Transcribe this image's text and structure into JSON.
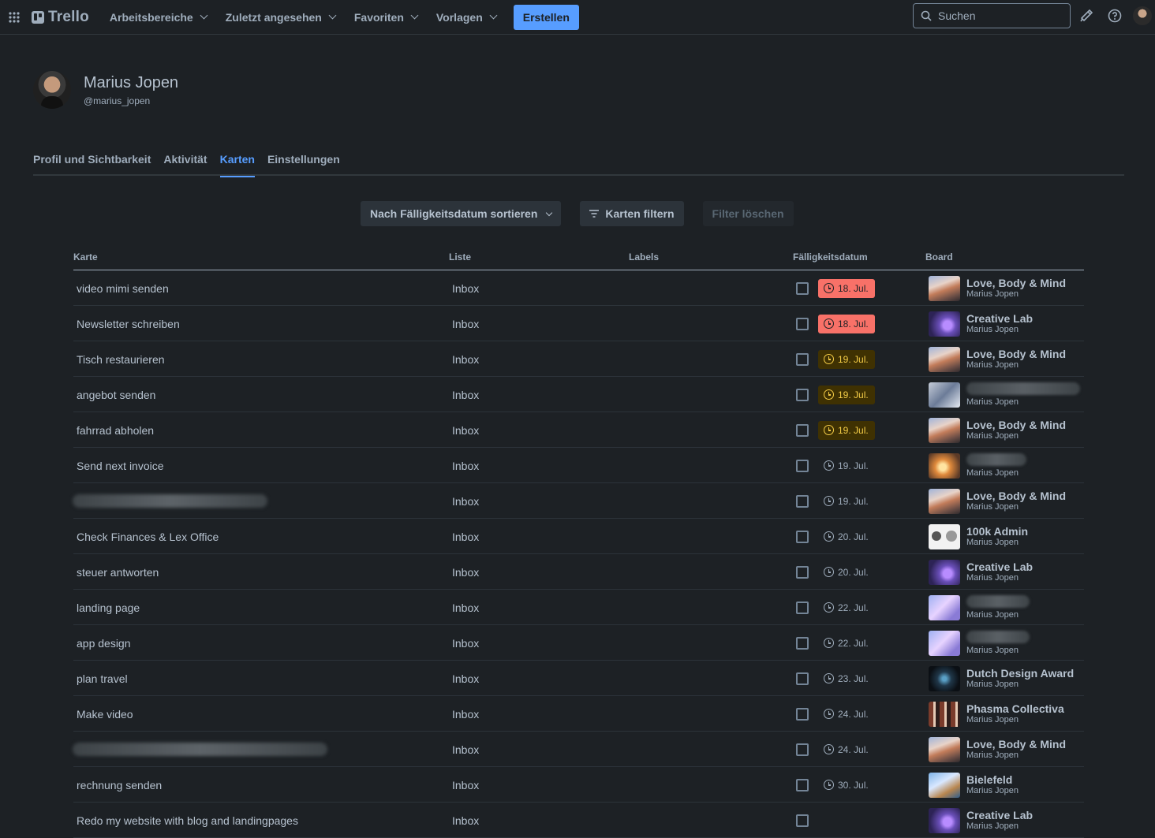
{
  "nav": {
    "logo": "Trello",
    "items": [
      "Arbeitsbereiche",
      "Zuletzt angesehen",
      "Favoriten",
      "Vorlagen"
    ],
    "create": "Erstellen",
    "search_placeholder": "Suchen"
  },
  "profile": {
    "name": "Marius Jopen",
    "handle": "@marius_jopen"
  },
  "tabs": [
    "Profil und Sichtbarkeit",
    "Aktivität",
    "Karten",
    "Einstellungen"
  ],
  "active_tab": "Karten",
  "controls": {
    "sort": "Nach Fälligkeitsdatum sortieren",
    "filter": "Karten filtern",
    "clear": "Filter löschen"
  },
  "columns": {
    "card": "Karte",
    "list": "Liste",
    "labels": "Labels",
    "due": "Fälligkeitsdatum",
    "board": "Board"
  },
  "colors": {
    "accent": "#579dff",
    "overdue": "#f87168",
    "due_soon": "#f5cd47",
    "background": "#1d2125"
  },
  "rows": [
    {
      "card": "video mimi senden",
      "list": "Inbox",
      "due": "18. Jul.",
      "status": "overdue",
      "board": "Love, Body & Mind",
      "owner": "Marius Jopen",
      "thumb": "t-love"
    },
    {
      "card": "Newsletter schreiben",
      "list": "Inbox",
      "due": "18. Jul.",
      "status": "overdue",
      "board": "Creative Lab",
      "owner": "Marius Jopen",
      "thumb": "t-creative"
    },
    {
      "card": "Tisch restaurieren",
      "list": "Inbox",
      "due": "19. Jul.",
      "status": "soon",
      "board": "Love, Body & Mind",
      "owner": "Marius Jopen",
      "thumb": "t-love"
    },
    {
      "card": "angebot senden",
      "list": "Inbox",
      "due": "19. Jul.",
      "status": "soon",
      "board": "",
      "board_blur": 144,
      "owner": "Marius Jopen",
      "thumb": "t-grey"
    },
    {
      "card": "fahrrad abholen",
      "list": "Inbox",
      "due": "19. Jul.",
      "status": "soon",
      "board": "Love, Body & Mind",
      "owner": "Marius Jopen",
      "thumb": "t-love"
    },
    {
      "card": "Send next invoice",
      "list": "Inbox",
      "due": "19. Jul.",
      "status": "normal",
      "board": "",
      "board_blur": 76,
      "owner": "Marius Jopen",
      "thumb": "t-orange"
    },
    {
      "card": "",
      "card_blur": 247,
      "list": "Inbox",
      "due": "19. Jul.",
      "status": "normal",
      "board": "Love, Body & Mind",
      "owner": "Marius Jopen",
      "thumb": "t-love"
    },
    {
      "card": "Check Finances & Lex Office",
      "list": "Inbox",
      "due": "20. Jul.",
      "status": "normal",
      "board": "100k Admin",
      "owner": "Marius Jopen",
      "thumb": "t-admin"
    },
    {
      "card": "steuer antworten",
      "list": "Inbox",
      "due": "20. Jul.",
      "status": "normal",
      "board": "Creative Lab",
      "owner": "Marius Jopen",
      "thumb": "t-creative"
    },
    {
      "card": "landing page",
      "list": "Inbox",
      "due": "22. Jul.",
      "status": "normal",
      "board": "",
      "board_blur": 80,
      "owner": "Marius Jopen",
      "thumb": "t-lav"
    },
    {
      "card": "app design",
      "list": "Inbox",
      "due": "22. Jul.",
      "status": "normal",
      "board": "",
      "board_blur": 80,
      "owner": "Marius Jopen",
      "thumb": "t-lav"
    },
    {
      "card": "plan travel",
      "list": "Inbox",
      "due": "23. Jul.",
      "status": "normal",
      "board": "Dutch Design Award",
      "owner": "Marius Jopen",
      "thumb": "t-dutch"
    },
    {
      "card": "Make video",
      "list": "Inbox",
      "due": "24. Jul.",
      "status": "normal",
      "board": "Phasma Collectiva",
      "owner": "Marius Jopen",
      "thumb": "t-phasma"
    },
    {
      "card": "",
      "card_blur": 323,
      "list": "Inbox",
      "due": "24. Jul.",
      "status": "normal",
      "board": "Love, Body & Mind",
      "owner": "Marius Jopen",
      "thumb": "t-love"
    },
    {
      "card": "rechnung senden",
      "list": "Inbox",
      "due": "30. Jul.",
      "status": "normal",
      "board": "Bielefeld",
      "owner": "Marius Jopen",
      "thumb": "t-biel"
    },
    {
      "card": "Redo my website with blog and landingpages",
      "list": "Inbox",
      "due": "",
      "status": "normal",
      "board": "Creative Lab",
      "owner": "Marius Jopen",
      "thumb": "t-creative"
    }
  ]
}
